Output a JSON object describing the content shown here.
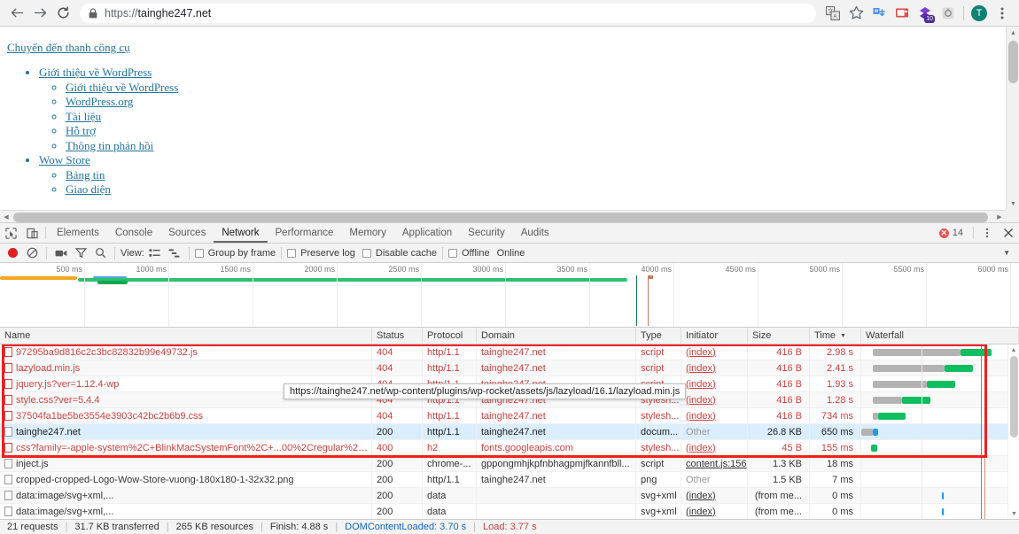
{
  "browser": {
    "back_label": "Back",
    "forward_label": "Forward",
    "reload_label": "Reload",
    "url_scheme": "https://",
    "url_host": "tainghe247.net",
    "lock_label": "secure-connection",
    "avatar_initial": "T",
    "extension_badge": "10",
    "icons": [
      "translate-icon",
      "bookmark-star-icon",
      "extension-download-icon",
      "extension-video-icon",
      "extension-purple-icon",
      "extension-gray-icon",
      "profile-avatar",
      "chrome-menu-icon"
    ]
  },
  "page": {
    "skip_link": "Chuyển đến thanh công cụ",
    "menu": [
      {
        "label": "Giới thiệu về WordPress",
        "children": [
          "Giới thiệu về WordPress",
          "WordPress.org",
          "Tài liệu",
          "Hỗ trợ",
          "Thông tin phản hồi"
        ]
      },
      {
        "label": "Wow Store",
        "children": [
          "Bảng tin",
          "Giao diện"
        ]
      }
    ]
  },
  "devtools": {
    "tabs": [
      {
        "label": "Elements",
        "active": false
      },
      {
        "label": "Console",
        "active": false
      },
      {
        "label": "Sources",
        "active": false
      },
      {
        "label": "Network",
        "active": true
      },
      {
        "label": "Performance",
        "active": false
      },
      {
        "label": "Memory",
        "active": false
      },
      {
        "label": "Application",
        "active": false
      },
      {
        "label": "Security",
        "active": false
      },
      {
        "label": "Audits",
        "active": false
      }
    ],
    "error_count": "14",
    "more_label": "⋮",
    "close_label": "✕",
    "toolbar": {
      "record_label": "record-stop",
      "clear_label": "clear",
      "filmstrip_label": "capture-screenshots",
      "filter_label": "filter",
      "search_label": "search",
      "view_label": "View:",
      "group_by_frame": "Group by frame",
      "preserve_log": "Preserve log",
      "disable_cache": "Disable cache",
      "offline": "Offline",
      "throttling": "Online"
    },
    "timeline": {
      "ticks": [
        "500 ms",
        "1000 ms",
        "1500 ms",
        "2000 ms",
        "2500 ms",
        "3000 ms",
        "3500 ms",
        "4000 ms",
        "4500 ms",
        "5000 ms",
        "5500 ms",
        "6000 ms"
      ],
      "dcl_label": "DOMContentLoaded",
      "load_label": "Load"
    },
    "columns": [
      "Name",
      "Status",
      "Protocol",
      "Domain",
      "Type",
      "Initiator",
      "Size",
      "Time",
      "Waterfall"
    ],
    "sort_column": "Time",
    "rows": [
      {
        "name": "97295ba9d816c2c3bc82832b99e49732.js",
        "status": "404",
        "protocol": "http/1.1",
        "domain": "tainghe247.net",
        "type": "script",
        "initiator": "(index)",
        "size": "416 B",
        "time": "2.98 s",
        "state": "error",
        "wf_start": 8,
        "wf_wait": 62,
        "wf_dl": 22,
        "wf_color": "#0fbf5f"
      },
      {
        "name": "lazyload.min.js",
        "status": "404",
        "protocol": "http/1.1",
        "domain": "tainghe247.net",
        "type": "script",
        "initiator": "(index)",
        "size": "416 B",
        "time": "2.41 s",
        "state": "error",
        "wf_start": 8,
        "wf_wait": 51,
        "wf_dl": 20,
        "wf_color": "#0fbf5f"
      },
      {
        "name": "jquery.js?ver=1.12.4-wp",
        "status": "404",
        "protocol": "http/1.1",
        "domain": "tainghe247.net",
        "type": "script",
        "initiator": "(index)",
        "size": "416 B",
        "time": "1.93 s",
        "state": "error",
        "wf_start": 8,
        "wf_wait": 38,
        "wf_dl": 20,
        "wf_color": "#0fbf5f"
      },
      {
        "name": "style.css?ver=5.4.4",
        "status": "404",
        "protocol": "http/1.1",
        "domain": "tainghe247.net",
        "type": "stylesh...",
        "initiator": "(index)",
        "size": "416 B",
        "time": "1.28 s",
        "state": "error",
        "wf_start": 8,
        "wf_wait": 21,
        "wf_dl": 20,
        "wf_color": "#0fbf5f"
      },
      {
        "name": "37504fa1be5be3554e3903c42bc2b6b9.css",
        "status": "404",
        "protocol": "http/1.1",
        "domain": "tainghe247.net",
        "type": "stylesh...",
        "initiator": "(index)",
        "size": "416 B",
        "time": "734 ms",
        "state": "error",
        "wf_start": 8,
        "wf_wait": 4,
        "wf_dl": 19,
        "wf_color": "#0fbf5f"
      },
      {
        "name": "tainghe247.net",
        "status": "200",
        "protocol": "http/1.1",
        "domain": "tainghe247.net",
        "type": "docum...",
        "initiator": "Other",
        "size": "26.8 KB",
        "time": "650 ms",
        "state": "selected",
        "wf_start": 0,
        "wf_wait": 8,
        "wf_dl": 4,
        "wf_color": "#2196f3"
      },
      {
        "name": "css?family=-apple-system%2C+BlinkMacSystemFont%2C+...00%2Cregular%2C700...",
        "status": "400",
        "protocol": "h2",
        "domain": "fonts.googleapis.com",
        "type": "stylesh...",
        "initiator": "(index)",
        "size": "45 B",
        "time": "155 ms",
        "state": "error",
        "wf_start": 7,
        "wf_wait": 0,
        "wf_dl": 4,
        "wf_color": "#0fbf5f"
      },
      {
        "name": "inject.js",
        "status": "200",
        "protocol": "chrome-...",
        "domain": "gppongmhjkpfnbhagpmjfkannfbll...",
        "type": "script",
        "initiator": "content.js:156",
        "size": "1.3 KB",
        "time": "18 ms",
        "state": "normal",
        "wf_start": 0,
        "wf_wait": 0,
        "wf_dl": 0,
        "wf_color": "#0fbf5f"
      },
      {
        "name": "cropped-cropped-Logo-Wow-Store-vuong-180x180-1-32x32.png",
        "status": "200",
        "protocol": "http/1.1",
        "domain": "tainghe247.net",
        "type": "png",
        "initiator": "Other",
        "size": "1.5 KB",
        "time": "7 ms",
        "state": "normal",
        "wf_start": 0,
        "wf_wait": 0,
        "wf_dl": 0,
        "wf_color": "#0fbf5f"
      },
      {
        "name": "data:image/svg+xml,...",
        "status": "200",
        "protocol": "data",
        "domain": "",
        "type": "svg+xml",
        "initiator": "(index)",
        "size": "(from me...",
        "time": "0 ms",
        "state": "muted",
        "wf_start": 57,
        "wf_wait": 0,
        "wf_dl": 0,
        "wf_color": "#2196f3"
      },
      {
        "name": "data:image/svg+xml,...",
        "status": "200",
        "protocol": "data",
        "domain": "",
        "type": "svg+xml",
        "initiator": "(index)",
        "size": "(from me...",
        "time": "0 ms",
        "state": "muted",
        "wf_start": 57,
        "wf_wait": 0,
        "wf_dl": 0,
        "wf_color": "#2196f3"
      }
    ],
    "tooltip": "https://tainghe247.net/wp-content/plugins/wp-rocket/assets/js/lazyload/16.1/lazyload.min.js",
    "status_bar": {
      "requests": "21 requests",
      "transferred": "31.7 KB transferred",
      "resources": "265 KB resources",
      "finish": "Finish: 4.88 s",
      "dcl": "DOMContentLoaded: 3.70 s",
      "load": "Load: 3.77 s"
    }
  },
  "colors": {
    "error_red": "#d43f3f",
    "selection_red": "#f02020",
    "download_green": "#0fbf5f",
    "wait_gray": "#b3b3b3",
    "dcl_blue": "#1565c0",
    "load_red": "#d43f3f",
    "selected_row": "#dbeeff"
  }
}
